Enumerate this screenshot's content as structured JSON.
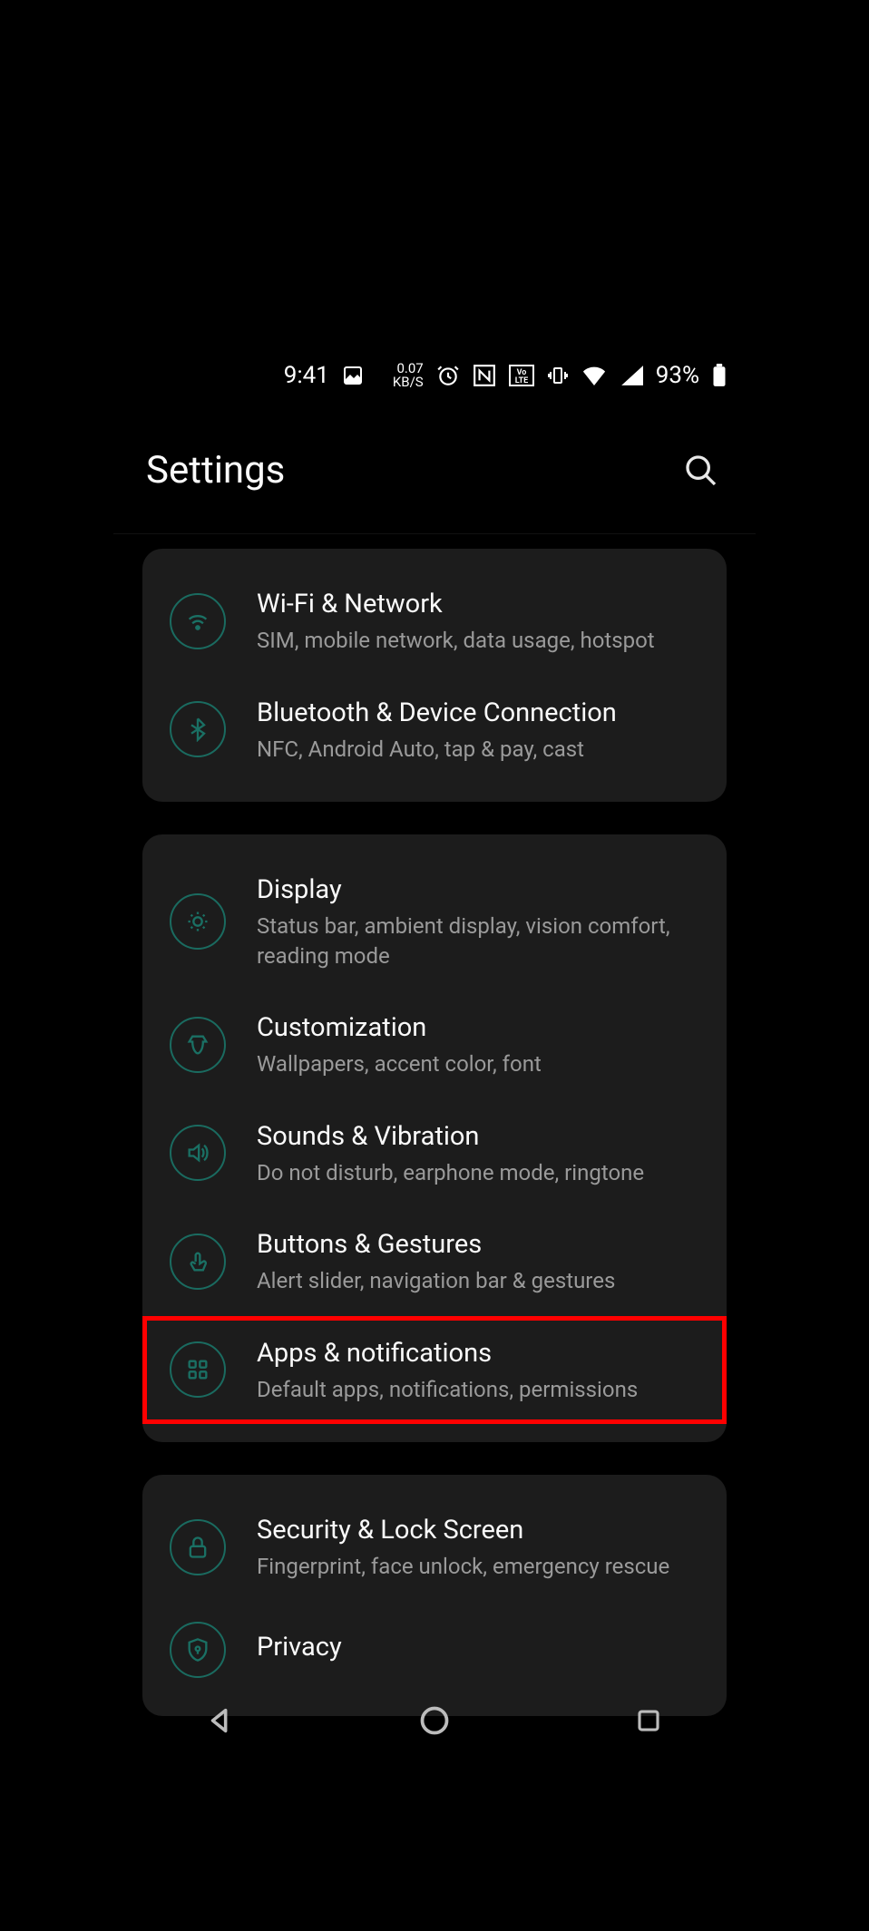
{
  "status": {
    "time": "9:41",
    "kbs_top": "0.07",
    "kbs_bottom": "KB/S",
    "battery_pct": "93%"
  },
  "header": {
    "title": "Settings"
  },
  "groups": [
    {
      "items": [
        {
          "icon": "wifi",
          "title": "Wi-Fi & Network",
          "sub": "SIM, mobile network, data usage, hotspot",
          "highlight": false
        },
        {
          "icon": "bluetooth",
          "title": "Bluetooth & Device Connection",
          "sub": "NFC, Android Auto, tap & pay, cast",
          "highlight": false
        }
      ]
    },
    {
      "items": [
        {
          "icon": "display",
          "title": "Display",
          "sub": "Status bar, ambient display, vision comfort, reading mode",
          "highlight": false
        },
        {
          "icon": "customization",
          "title": "Customization",
          "sub": "Wallpapers, accent color, font",
          "highlight": false
        },
        {
          "icon": "sound",
          "title": "Sounds & Vibration",
          "sub": "Do not disturb, earphone mode, ringtone",
          "highlight": false
        },
        {
          "icon": "gestures",
          "title": "Buttons & Gestures",
          "sub": "Alert slider, navigation bar & gestures",
          "highlight": false
        },
        {
          "icon": "apps",
          "title": "Apps & notifications",
          "sub": "Default apps, notifications, permissions",
          "highlight": true
        }
      ]
    },
    {
      "items": [
        {
          "icon": "lock",
          "title": "Security & Lock Screen",
          "sub": "Fingerprint, face unlock, emergency rescue",
          "highlight": false
        },
        {
          "icon": "privacy",
          "title": "Privacy",
          "sub": "",
          "highlight": false
        }
      ]
    }
  ]
}
